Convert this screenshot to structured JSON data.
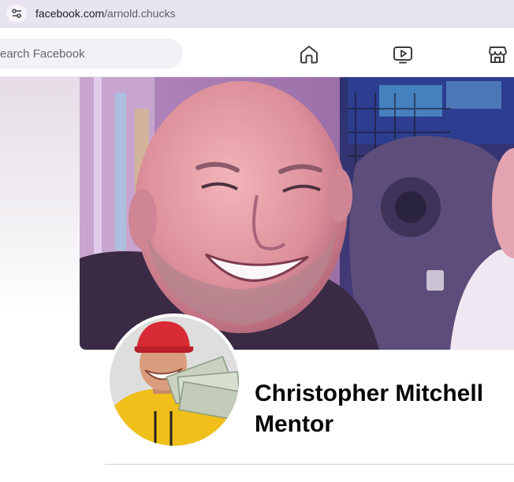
{
  "browser": {
    "url_domain": "facebook.com",
    "url_path": "/arnold.chucks",
    "site_info_icon": "tune-icon"
  },
  "nav": {
    "search_placeholder": "earch Facebook",
    "icons": [
      "home-icon",
      "video-icon",
      "marketplace-icon"
    ]
  },
  "profile": {
    "name_line1": "Christopher Mitchell",
    "name_line2": "Mentor"
  },
  "colors": {
    "url_bar_bg": "#e9e4f1",
    "search_bg": "#f0f2f5",
    "name_text": "#050505",
    "avatar_hat": "#d92b35",
    "avatar_hoodie": "#f0bf1a"
  }
}
